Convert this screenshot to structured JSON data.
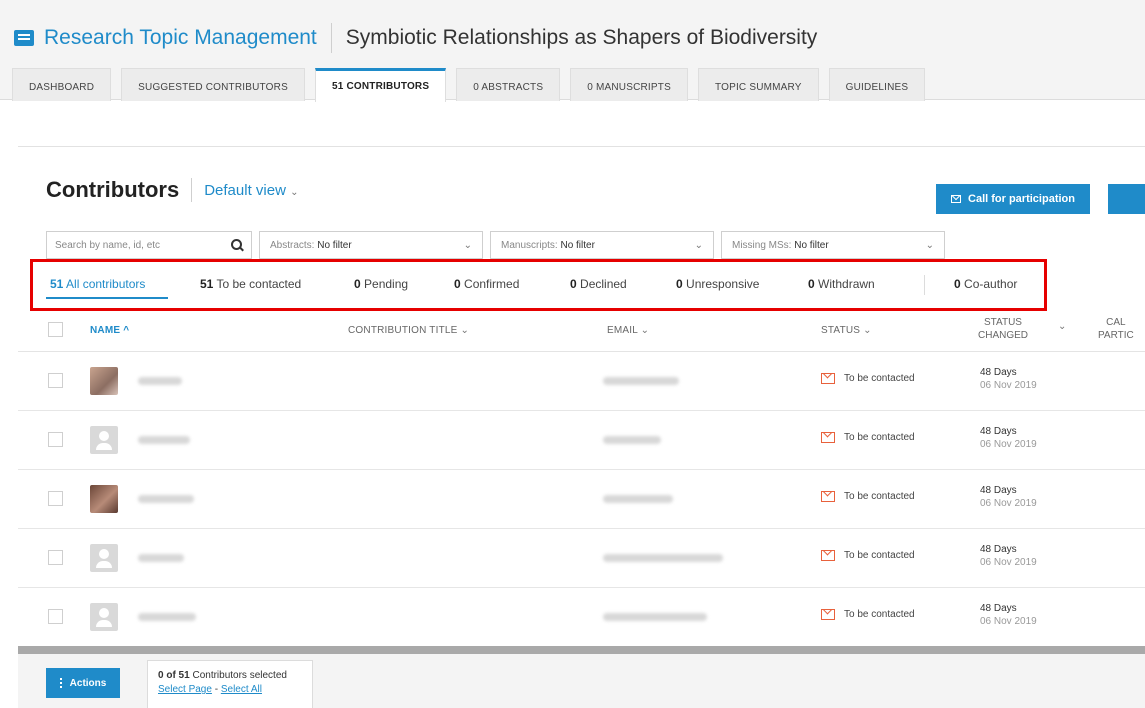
{
  "header": {
    "app_title": "Research Topic Management",
    "topic_title": "Symbiotic Relationships as Shapers of Biodiversity"
  },
  "tabs": [
    {
      "label": "DASHBOARD"
    },
    {
      "label": "SUGGESTED CONTRIBUTORS"
    },
    {
      "label": "51 CONTRIBUTORS",
      "active": true
    },
    {
      "label": "0 ABSTRACTS"
    },
    {
      "label": "0 MANUSCRIPTS"
    },
    {
      "label": "TOPIC SUMMARY"
    },
    {
      "label": "GUIDELINES"
    }
  ],
  "contributors": {
    "title": "Contributors",
    "view_label": "Default view",
    "call_button": "Call for participation"
  },
  "filters": {
    "search_placeholder": "Search by name, id, etc",
    "abstracts_label": "Abstracts:",
    "abstracts_value": "No filter",
    "manuscripts_label": "Manuscripts:",
    "manuscripts_value": "No filter",
    "missing_label": "Missing MSs:",
    "missing_value": "No filter"
  },
  "status_tabs": [
    {
      "count": "51",
      "label": "All contributors"
    },
    {
      "count": "51",
      "label": "To be contacted"
    },
    {
      "count": "0",
      "label": "Pending"
    },
    {
      "count": "0",
      "label": "Confirmed"
    },
    {
      "count": "0",
      "label": "Declined"
    },
    {
      "count": "0",
      "label": "Unresponsive"
    },
    {
      "count": "0",
      "label": "Withdrawn"
    },
    {
      "count": "0",
      "label": "Co-author"
    }
  ],
  "columns": {
    "name": "NAME",
    "contribution_title": "CONTRIBUTION TITLE",
    "email": "EMAIL",
    "status": "STATUS",
    "status_changed_1": "STATUS",
    "status_changed_2": "CHANGED",
    "call_1": "CAL",
    "call_2": "PARTIC"
  },
  "rows": [
    {
      "status": "To be contacted",
      "days": "48 Days",
      "date": "06 Nov 2019"
    },
    {
      "status": "To be contacted",
      "days": "48 Days",
      "date": "06 Nov 2019"
    },
    {
      "status": "To be contacted",
      "days": "48 Days",
      "date": "06 Nov 2019"
    },
    {
      "status": "To be contacted",
      "days": "48 Days",
      "date": "06 Nov 2019"
    },
    {
      "status": "To be contacted",
      "days": "48 Days",
      "date": "06 Nov 2019"
    }
  ],
  "footer": {
    "actions_label": "Actions",
    "selected_count": "0 of 51",
    "selected_text": "Contributors selected",
    "select_page": "Select Page",
    "separator": "-",
    "select_all": "Select All"
  },
  "colors": {
    "accent": "#1f8bc9",
    "status_icon": "#e8613c",
    "highlight": "#e60000"
  },
  "icons": [
    "document-icon",
    "search-icon",
    "chevron-down-icon",
    "mail-icon",
    "sort-up-icon",
    "avatar-default-icon",
    "kebab-icon"
  ]
}
